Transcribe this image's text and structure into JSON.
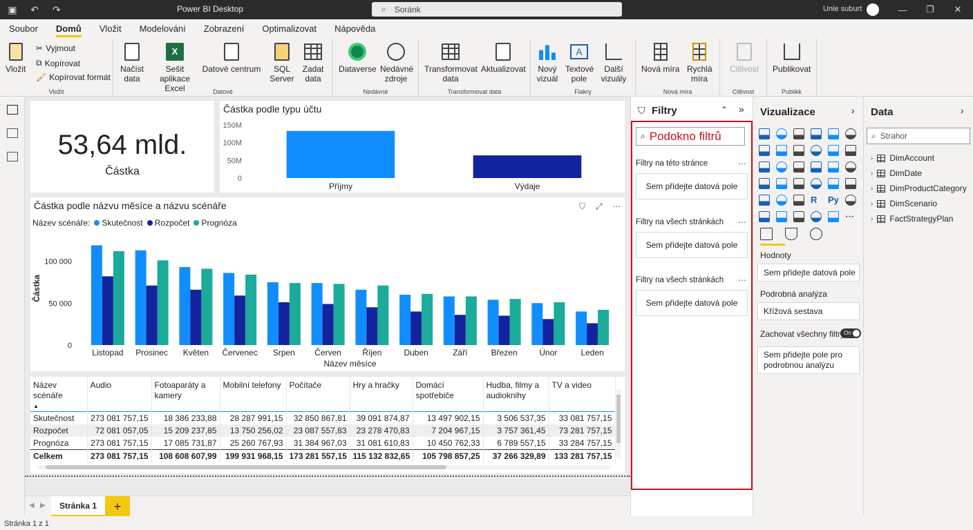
{
  "titlebar": {
    "app_title": "Power BI Desktop",
    "search_placeholder": "Soránk",
    "user_name": "Unie suburt"
  },
  "menu": [
    "Soubor",
    "Domů",
    "Vložit",
    "Modelování",
    "Zobrazení",
    "Optimalizovat",
    "Nápověda"
  ],
  "ribbon": {
    "clipboard": {
      "paste": "Vložit",
      "cut": "Vyjmout",
      "copy": "Kopírovat",
      "format": "Kopírovat formát",
      "group": "Vložit"
    },
    "data": {
      "get_data": "Načíst data",
      "excel": "Sešit aplikace Excel",
      "datahub": "Datové centrum",
      "sql": "SQL Server",
      "enter": "Zadat data",
      "group": "Datové"
    },
    "recent": {
      "dataverse": "Dataverse",
      "recent": "Nedávné zdroje",
      "group": "Nedávné"
    },
    "transform": {
      "transform": "Transformovat data",
      "refresh": "Aktualizovat",
      "group": "Transformovat data"
    },
    "insert": {
      "new_visual": "Nový vizuál",
      "textbox": "Textové pole",
      "more": "Další vizuály",
      "group": "Flakry"
    },
    "calc": {
      "new_measure": "Nová míra",
      "quick_measure": "Rychlá míra",
      "group": "Nová míra"
    },
    "sensitivity": {
      "label": "Citlivost",
      "group": "Citlivost"
    },
    "publish": {
      "label": "Publikovat",
      "group": "Publikk"
    }
  },
  "card": {
    "value": "53,64 mld.",
    "label": "Částka"
  },
  "bar_visual": {
    "title": "Částka podle typu účtu",
    "chart_data": {
      "type": "bar",
      "categories": [
        "Příjmy",
        "Výdaje"
      ],
      "values": [
        133,
        64
      ],
      "ylim": [
        0,
        150
      ],
      "yticks": [
        "0",
        "50M",
        "100M",
        "150M"
      ],
      "colors": [
        "#118dff",
        "#12239e"
      ],
      "grid": false
    }
  },
  "column_visual": {
    "title": "Částka podle názvu měsíce a názvu scénáře",
    "legend_title": "Název scénáře:",
    "xlabel": "Název měsíce",
    "ylabel": "Částka",
    "chart_data": {
      "type": "bar",
      "categories": [
        "Listopad",
        "Prosinec",
        "Květen",
        "Červenec",
        "Srpen",
        "Červen",
        "Říjen",
        "Duben",
        "Září",
        "Březen",
        "Únor",
        "Leden"
      ],
      "series": [
        {
          "name": "Skutečnost",
          "color": "#118dff",
          "values": [
            119000,
            113000,
            93000,
            86000,
            75000,
            74000,
            66000,
            60000,
            58000,
            54000,
            50000,
            40000
          ]
        },
        {
          "name": "Rozpočet",
          "color": "#12239e",
          "values": [
            82000,
            71000,
            66000,
            59000,
            51000,
            49000,
            45000,
            40000,
            36000,
            35000,
            31000,
            26000
          ]
        },
        {
          "name": "Prognóza",
          "color": "#1aab9b",
          "values": [
            112000,
            101000,
            91000,
            84000,
            74000,
            73000,
            71000,
            61000,
            58000,
            55000,
            51000,
            42000
          ]
        }
      ],
      "ylim": [
        0,
        135000
      ],
      "yticks": [
        "0",
        "50 000",
        "100 000"
      ],
      "legend": "top-left",
      "grid": false
    }
  },
  "table_visual": {
    "columns": [
      "Název scénáře",
      "Audio",
      "Fotoaparáty a kamery",
      "Mobilní telefony",
      "Počítače",
      "Hry a hračky",
      "Domácí spotřebiče",
      "Hudba, filmy a audioknihy",
      "TV a video"
    ],
    "rows": [
      [
        "Skutečnost",
        "273 081 757,15",
        "18 386 233,88",
        "28 287 991,15",
        "32 850 867,81",
        "39 091 874,87",
        "13 497 902,15",
        "3 506 537,35",
        "33 081 757,15"
      ],
      [
        "Rozpočet",
        "72 081 057,05",
        "15 209 237,85",
        "13 750 256,02",
        "23 087 557,83",
        "23 278 470,83",
        "7 204 967,15",
        "3 757 361,45",
        "73 281 757,15"
      ],
      [
        "Prognóza",
        "273 081 757,15",
        "17 085 731,87",
        "25 260 767,93",
        "31 384 967,03",
        "31 081 610,83",
        "10 450 762,33",
        "6 789 557,15",
        "33 284 757,15"
      ]
    ],
    "total": [
      "Celkem",
      "273 081 757,15",
      "108 608 607,99",
      "199 931 968,15",
      "173 281 557,15",
      "115 132 832,65",
      "105 798 857,25",
      "37 266 329,89",
      "133 281 757,15"
    ]
  },
  "pages": {
    "tab": "Stránka 1",
    "add": "+",
    "status": "Stránka 1 z 1"
  },
  "filters": {
    "title": "Filtry",
    "search": "Podokno filtrů",
    "sections": [
      {
        "title": "Filtry na této stránce",
        "well": "Sem přidejte datová pole"
      },
      {
        "title": "Filtry na všech stránkách",
        "well": "Sem přidejte datová pole"
      },
      {
        "title": "Filtry na všech stránkách",
        "well": "Sem přidejte datová pole"
      }
    ]
  },
  "viz": {
    "title": "Vizualizace",
    "values_label": "Hodnoty",
    "values_well": "Sem přidejte datová pole",
    "drill_label": "Podrobná analýza",
    "drill_well": "Křížová sestava",
    "keep_filters": "Zachovat všechny filtry",
    "toggle": "On",
    "drill_add": "Sem přidejte pole pro podrobnou analýzu",
    "text_icons": {
      "r": "R",
      "py": "Py",
      "more": "⋯"
    }
  },
  "data_pane": {
    "title": "Data",
    "search": "Strahor",
    "tables": [
      "DimAccount",
      "DimDate",
      "DimProductCategory",
      "DimScenario",
      "FactStrategyPlan"
    ]
  }
}
